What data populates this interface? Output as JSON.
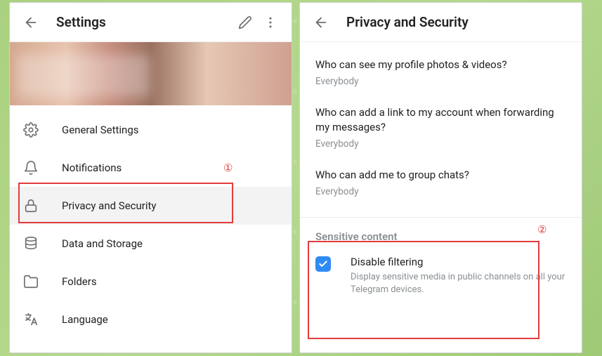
{
  "left": {
    "title": "Settings",
    "menu": [
      {
        "label": "General Settings"
      },
      {
        "label": "Notifications"
      },
      {
        "label": "Privacy and Security"
      },
      {
        "label": "Data and Storage"
      },
      {
        "label": "Folders"
      },
      {
        "label": "Language"
      }
    ],
    "active_index": 2,
    "callout_number": "①"
  },
  "right": {
    "title": "Privacy and Security",
    "items": [
      {
        "question": "Who can see my profile photos & videos?",
        "value": "Everybody"
      },
      {
        "question": "Who can add a link to my account when forwarding my messages?",
        "value": "Everybody"
      },
      {
        "question": "Who can add me to group chats?",
        "value": "Everybody"
      }
    ],
    "sensitive": {
      "section_title": "Sensitive content",
      "title": "Disable filtering",
      "subtitle": "Display sensitive media in public channels on all your Telegram devices.",
      "checked": true
    },
    "callout_number": "②"
  }
}
